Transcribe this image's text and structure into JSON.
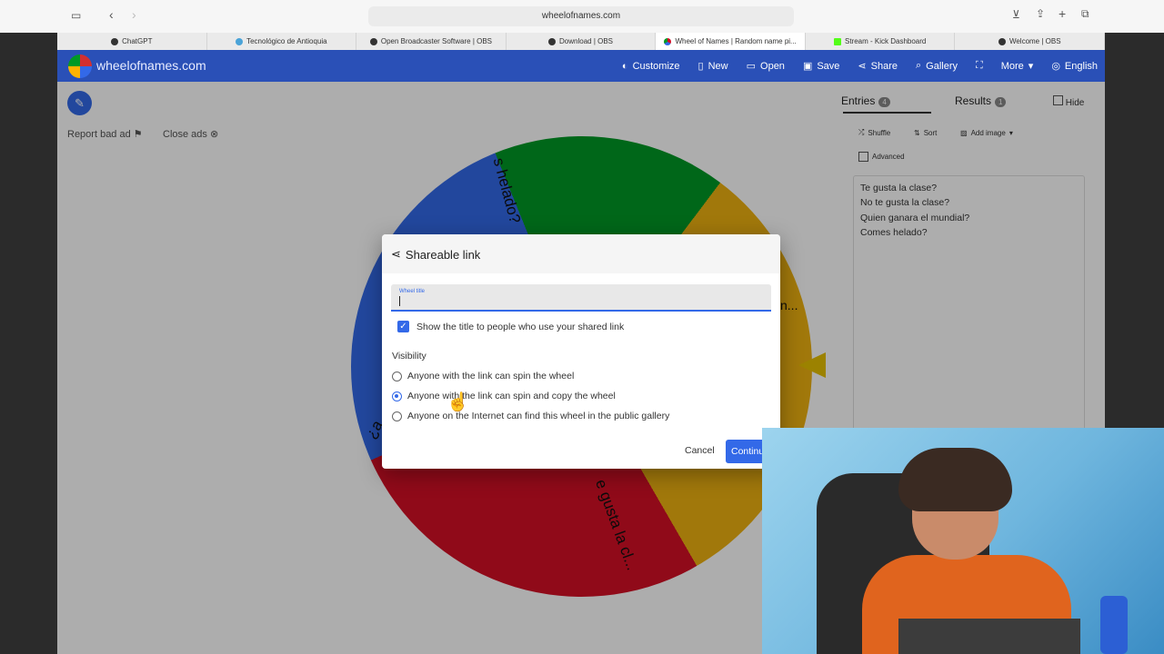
{
  "browser": {
    "url": "wheelofnames.com",
    "tabs": [
      {
        "label": "ChatGPT"
      },
      {
        "label": "Tecnológico de Antioquia"
      },
      {
        "label": "Open Broadcaster Software | OBS"
      },
      {
        "label": "Download | OBS"
      },
      {
        "label": "Wheel of Names | Random name pi..."
      },
      {
        "label": "Stream - Kick Dashboard"
      },
      {
        "label": "Welcome | OBS"
      }
    ]
  },
  "app": {
    "site_name": "wheelofnames.com",
    "menu": {
      "customize": "Customize",
      "new": "New",
      "open": "Open",
      "save": "Save",
      "share": "Share",
      "gallery": "Gallery",
      "more": "More",
      "language": "English"
    },
    "ads": {
      "report": "Report bad ad",
      "close": "Close ads"
    }
  },
  "panel": {
    "entries_tab": "Entries",
    "entries_count": "4",
    "results_tab": "Results",
    "results_count": "1",
    "hide": "Hide",
    "shuffle": "Shuffle",
    "sort": "Sort",
    "add_image": "Add image",
    "advanced": "Advanced",
    "entries": [
      "Te gusta la clase?",
      "No te gusta la clase?",
      "Quien ganara el mundial?",
      "Comes helado?"
    ]
  },
  "wheel": {
    "segment_texts": [
      "s helado?",
      "n...",
      "e gusta la cl...",
      "¿a"
    ]
  },
  "dialog": {
    "title": "Shareable link",
    "field_label": "Wheel title",
    "field_value": "",
    "show_title_label": "Show the title to people who use your shared link",
    "show_title_checked": true,
    "visibility_label": "Visibility",
    "options": [
      {
        "label": "Anyone with the link can spin the wheel",
        "selected": false
      },
      {
        "label": "Anyone with the link can spin and copy the wheel",
        "selected": true
      },
      {
        "label": "Anyone on the Internet can find this wheel in the public gallery",
        "selected": false
      }
    ],
    "cancel": "Cancel",
    "continue": "Continu"
  },
  "colors": {
    "brand_blue": "#3369e8",
    "appbar": "#2a50b7",
    "wheel_green": "#009925",
    "wheel_yellow": "#eeb211",
    "wheel_red": "#d50f25",
    "wheel_blue": "#3369e8"
  }
}
